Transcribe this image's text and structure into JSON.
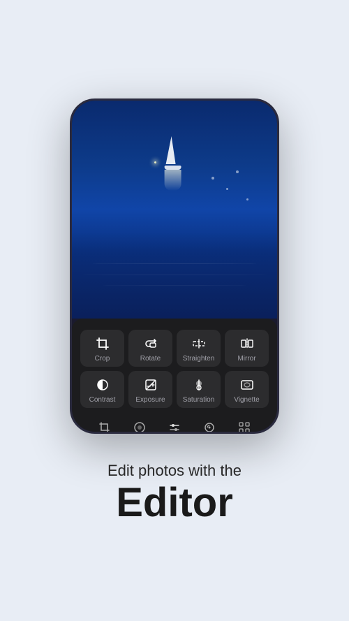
{
  "page": {
    "background_color": "#e8edf5"
  },
  "phone": {
    "tools": [
      {
        "id": "crop",
        "label": "Crop",
        "icon": "crop"
      },
      {
        "id": "rotate",
        "label": "Rotate",
        "icon": "rotate"
      },
      {
        "id": "straighten",
        "label": "Straighten",
        "icon": "straighten"
      },
      {
        "id": "mirror",
        "label": "Mirror",
        "icon": "mirror"
      },
      {
        "id": "contrast",
        "label": "Contrast",
        "icon": "contrast"
      },
      {
        "id": "exposure",
        "label": "Exposure",
        "icon": "exposure"
      },
      {
        "id": "saturation",
        "label": "Saturation",
        "icon": "saturation"
      },
      {
        "id": "vignette",
        "label": "Vignette",
        "icon": "vignette"
      }
    ],
    "bottom_nav": [
      {
        "id": "crop-nav",
        "icon": "crop-small"
      },
      {
        "id": "filter-nav",
        "icon": "filter"
      },
      {
        "id": "adjust-nav",
        "icon": "sliders"
      },
      {
        "id": "paint-nav",
        "icon": "paint"
      },
      {
        "id": "grid-nav",
        "icon": "grid"
      }
    ]
  },
  "text": {
    "subtitle": "Edit photos with the",
    "title": "Editor"
  }
}
